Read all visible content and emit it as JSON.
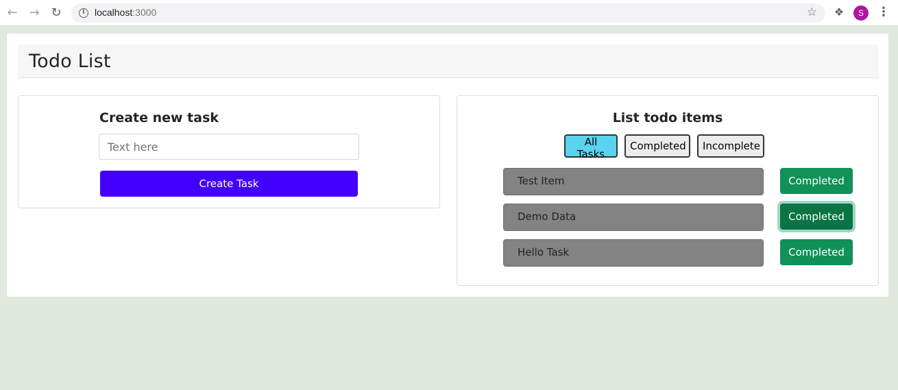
{
  "browser": {
    "url_host": "localhost",
    "url_port": ":3000"
  },
  "header": {
    "title": "Todo List"
  },
  "create": {
    "title": "Create new task",
    "input_placeholder": "Text here",
    "input_value": "",
    "button_label": "Create Task"
  },
  "list": {
    "title": "List todo items",
    "filters": [
      {
        "label": "All Tasks",
        "active": true
      },
      {
        "label": "Completed",
        "active": false
      },
      {
        "label": "Incomplete",
        "active": false
      }
    ],
    "items": [
      {
        "text": "Test Item",
        "status_label": "Completed"
      },
      {
        "text": "Demo Data",
        "status_label": "Completed"
      },
      {
        "text": "Hello Task",
        "status_label": "Completed"
      }
    ]
  },
  "colors": {
    "accent_button": "#4400ff",
    "status_button": "#0f9157",
    "active_filter": "#5ad3ee",
    "page_background": "#dfeadd"
  }
}
